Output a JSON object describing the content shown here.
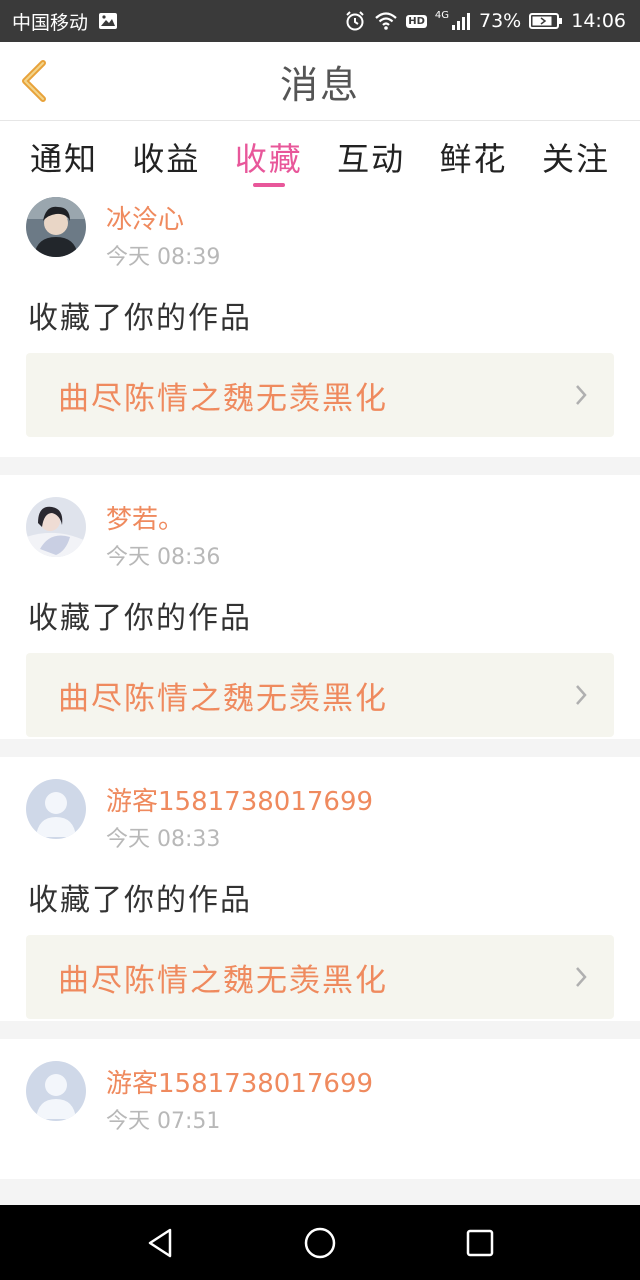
{
  "status_bar": {
    "carrier": "中国移动",
    "network_label": "4G",
    "hd_label": "HD",
    "battery": "73%",
    "time": "14:06",
    "icons": [
      "image-icon",
      "alarm-icon",
      "wifi-icon",
      "hd-icon",
      "signal-icon",
      "battery-icon"
    ]
  },
  "header": {
    "title": "消息",
    "back_icon": "chevron-left-icon",
    "accent_color": "#e8a23a"
  },
  "tabs": [
    {
      "label": "通知",
      "active": false
    },
    {
      "label": "收益",
      "active": false
    },
    {
      "label": "收藏",
      "active": true
    },
    {
      "label": "互动",
      "active": false
    },
    {
      "label": "鲜花",
      "active": false
    },
    {
      "label": "关注",
      "active": false
    }
  ],
  "theme": {
    "active_tab_color": "#e8579a",
    "name_color": "#ef8a5e",
    "link_bg": "#f5f5ee"
  },
  "messages": [
    {
      "user": "冰泠心",
      "time": "今天 08:39",
      "action": "收藏了你的作品",
      "work_title": "曲尽陈情之魏无羡黑化",
      "avatar": "photo-avatar-dark"
    },
    {
      "user": "梦若。",
      "time": "今天 08:36",
      "action": "收藏了你的作品",
      "work_title": "曲尽陈情之魏无羡黑化",
      "avatar": "photo-avatar-light"
    },
    {
      "user": "游客1581738017699",
      "time": "今天 08:33",
      "action": "收藏了你的作品",
      "work_title": "曲尽陈情之魏无羡黑化",
      "avatar": "default-avatar"
    },
    {
      "user": "游客1581738017699",
      "time": "今天 07:51",
      "avatar": "default-avatar"
    }
  ],
  "nav_bar": {
    "buttons": [
      "back-triangle-icon",
      "home-circle-icon",
      "recents-square-icon"
    ]
  }
}
